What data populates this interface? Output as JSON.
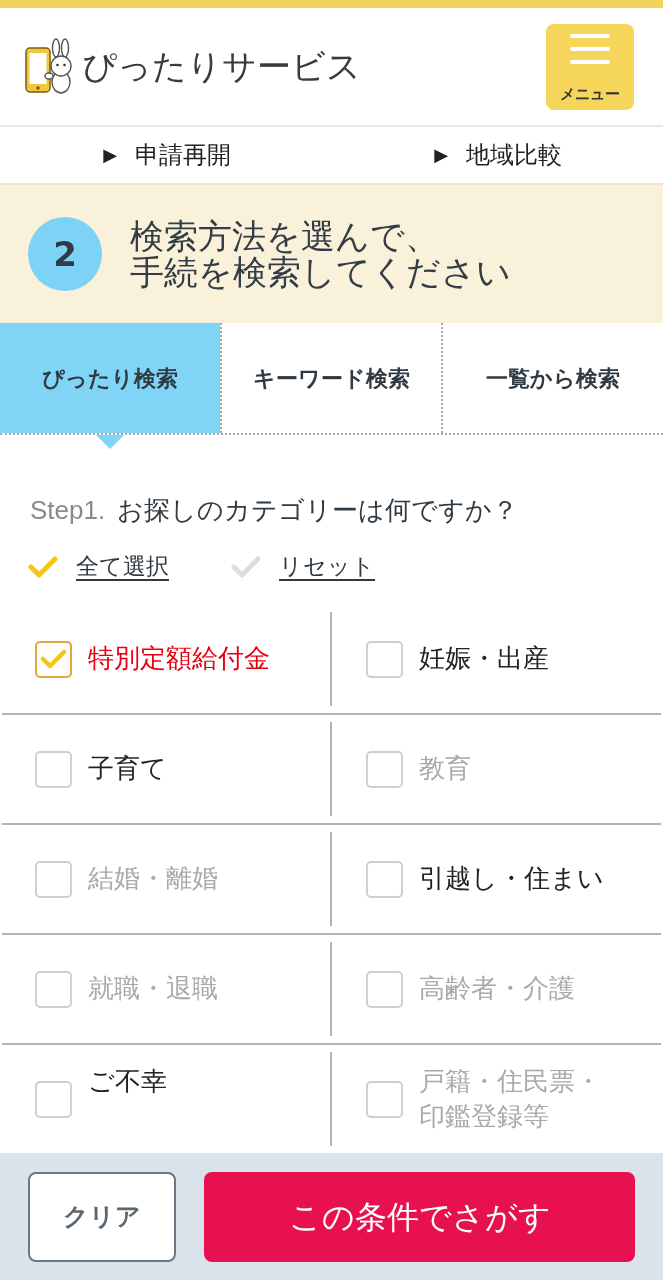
{
  "header": {
    "title": "ぴったりサービス",
    "menu_button": {
      "label": "メニュー"
    }
  },
  "quick_links": [
    {
      "marker": "▶",
      "label": "申請再開"
    },
    {
      "marker": "▶",
      "label": "地域比較"
    }
  ],
  "section": {
    "step_number": "2",
    "heading_lines": [
      "検索方法を選んで、",
      "手続を検索してください"
    ]
  },
  "tabs": [
    {
      "label": "ぴったり検索",
      "selected": true
    },
    {
      "label": "キーワード検索",
      "selected": false
    },
    {
      "label": "一覧から検索",
      "selected": false
    }
  ],
  "question": {
    "step_label": "Step1.",
    "text": "お探しのカテゴリーは何ですか？"
  },
  "bulk_actions": [
    {
      "label": "全て選択",
      "color": "#f5c518"
    },
    {
      "label": "リセット",
      "color": "#dddddd"
    }
  ],
  "categories": [
    {
      "label": "特別定額給付金",
      "checked": true,
      "disabled": false
    },
    {
      "label": "妊娠・出産",
      "checked": false,
      "disabled": false
    },
    {
      "label": "子育て",
      "checked": false,
      "disabled": false
    },
    {
      "label": "教育",
      "checked": false,
      "disabled": true
    },
    {
      "label": "結婚・離婚",
      "checked": false,
      "disabled": true
    },
    {
      "label": "引越し・住まい",
      "checked": false,
      "disabled": false
    },
    {
      "label": "就職・退職",
      "checked": false,
      "disabled": true
    },
    {
      "label": "高齢者・介護",
      "checked": false,
      "disabled": true
    },
    {
      "label": "ご不幸",
      "checked": false,
      "disabled": false
    },
    {
      "label": "戸籍・住民票・印鑑登録等",
      "checked": false,
      "disabled": true
    }
  ],
  "footer_buttons": {
    "clear": "クリア",
    "search": "この条件でさがす"
  }
}
